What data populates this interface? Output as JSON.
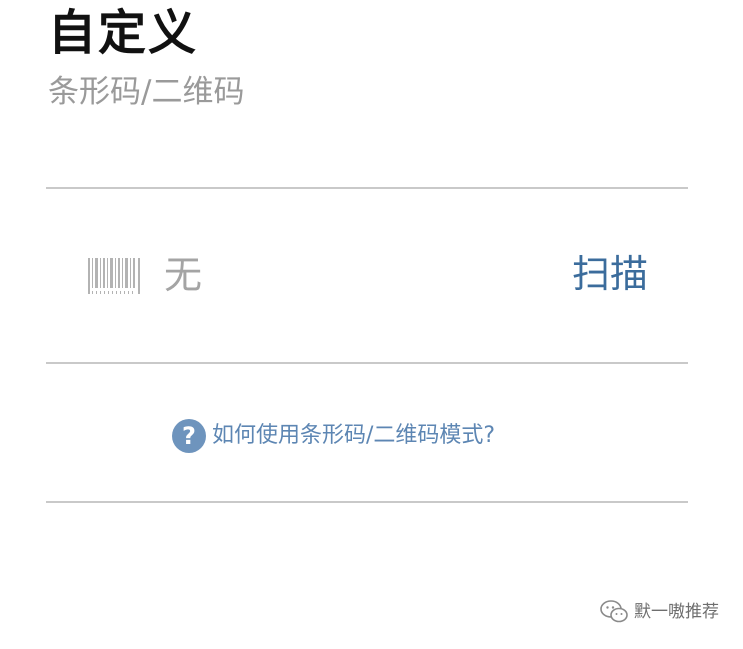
{
  "header": {
    "title": "自定义",
    "subtitle": "条形码/二维码"
  },
  "barcode": {
    "icon": "barcode-icon",
    "value": "无",
    "scan_label": "扫描"
  },
  "help": {
    "icon": "help-circle-icon",
    "text": "如何使用条形码/二维码模式?"
  },
  "watermark": {
    "icon": "wechat-icon",
    "text": "默一嗷推荐"
  },
  "colors": {
    "accent": "#3b6c9c",
    "link": "#5d86b3",
    "help_icon_bg": "#6e94bd",
    "muted_text": "#9a9a9a",
    "divider": "#c9c9c9"
  }
}
